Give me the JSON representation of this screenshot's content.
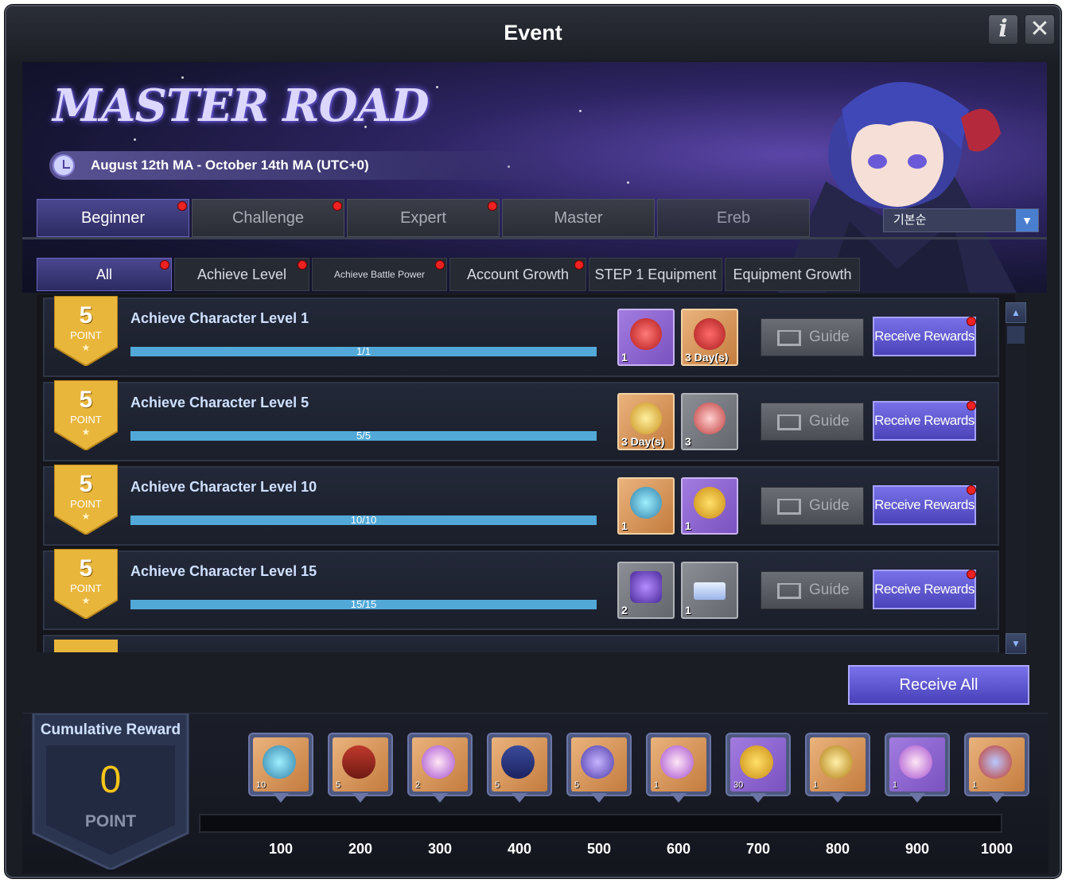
{
  "window": {
    "title": "Event",
    "info_label": "i",
    "close_label": "✕"
  },
  "banner": {
    "logo": "MASTER ROAD",
    "date_range": "August 12th MA - October 14th MA (UTC+0)"
  },
  "tabs": [
    {
      "label": "Beginner",
      "active": true,
      "dot": true
    },
    {
      "label": "Challenge",
      "active": false,
      "dot": true
    },
    {
      "label": "Expert",
      "active": false,
      "dot": true
    },
    {
      "label": "Master",
      "active": false,
      "dot": false
    },
    {
      "label": "Ereb",
      "active": false,
      "dot": false
    }
  ],
  "sort": {
    "selected": "기본순",
    "arrow": "▼"
  },
  "subtabs": [
    {
      "label": "All",
      "active": true,
      "dot": true
    },
    {
      "label": "Achieve Level",
      "active": false,
      "dot": true
    },
    {
      "label": "Achieve Battle Power",
      "active": false,
      "dot": true
    },
    {
      "label": "Account Growth",
      "active": false,
      "dot": true
    },
    {
      "label": "STEP 1 Equipment",
      "active": false,
      "dot": false
    },
    {
      "label": "Equipment Growth",
      "active": false,
      "dot": false
    }
  ],
  "mission_common": {
    "point_label": "POINT",
    "guide_label": "Guide",
    "receive_label": "Receive Rewards",
    "star": "★"
  },
  "missions": [
    {
      "points": "5",
      "title": "Achieve Character Level 1",
      "progress_text": "1/1",
      "progress": 1.0,
      "rewards": [
        {
          "color": "purple",
          "qty": "1",
          "icon": "red-gem-icon"
        },
        {
          "color": "orange",
          "qty": "3 Day(s)",
          "icon": "winged-gem-icon"
        }
      ]
    },
    {
      "points": "5",
      "title": "Achieve Character Level 5",
      "progress_text": "5/5",
      "progress": 1.0,
      "rewards": [
        {
          "color": "orange",
          "qty": "3 Day(s)",
          "icon": "gc-crest-icon"
        },
        {
          "color": "gray",
          "qty": "3",
          "icon": "b-coin-icon"
        }
      ]
    },
    {
      "points": "5",
      "title": "Achieve Character Level 10",
      "progress_text": "10/10",
      "progress": 1.0,
      "rewards": [
        {
          "color": "orange",
          "qty": "1",
          "icon": "gift-box-icon"
        },
        {
          "color": "purple",
          "qty": "1",
          "icon": "gold-coin-icon"
        }
      ]
    },
    {
      "points": "5",
      "title": "Achieve Character Level 15",
      "progress_text": "15/15",
      "progress": 1.0,
      "rewards": [
        {
          "color": "gray",
          "qty": "2",
          "icon": "purple-bag-icon"
        },
        {
          "color": "gray",
          "qty": "1",
          "icon": "ticket-icon"
        }
      ]
    }
  ],
  "receive_all": "Receive All",
  "cumulative": {
    "title": "Cumulative Reward",
    "value": "0",
    "point_label": "POINT",
    "progress": 0,
    "milestones": [
      {
        "mark": "100",
        "qty": "10",
        "color": "orange",
        "icon": "teal-cube-icon"
      },
      {
        "mark": "200",
        "qty": "5",
        "color": "orange",
        "icon": "red-ticket-icon"
      },
      {
        "mark": "300",
        "qty": "2",
        "color": "orange",
        "icon": "scroll-icon"
      },
      {
        "mark": "400",
        "qty": "5",
        "color": "orange",
        "icon": "blue-ticket-icon"
      },
      {
        "mark": "500",
        "qty": "5",
        "color": "orange",
        "icon": "purple-cube-icon"
      },
      {
        "mark": "600",
        "qty": "1",
        "color": "orange",
        "icon": "scroll-icon"
      },
      {
        "mark": "700",
        "qty": "30",
        "color": "purple",
        "icon": "gold-coin-icon"
      },
      {
        "mark": "800",
        "qty": "1",
        "color": "orange",
        "icon": "card-pack-icon"
      },
      {
        "mark": "900",
        "qty": "1",
        "color": "purple",
        "icon": "scroll-icon"
      },
      {
        "mark": "1000",
        "qty": "1",
        "color": "orange",
        "icon": "costume-icon"
      }
    ]
  }
}
